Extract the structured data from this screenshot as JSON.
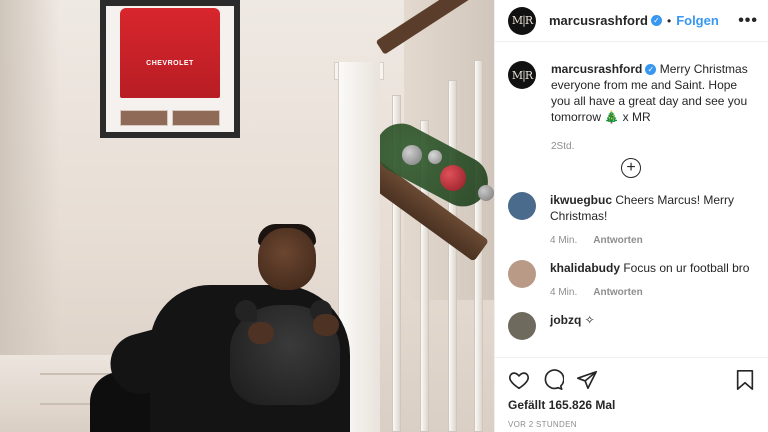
{
  "post": {
    "username": "marcusrashford",
    "verified_mark": "✓",
    "separator": "•",
    "follow_label": "Folgen",
    "more_label": "•••",
    "avatar_initials": "M|R",
    "caption_rest": " Merry Christmas everyone from me and Saint. Hope you all have a great day and see you tomorrow 🎄 x MR",
    "caption_time": "2Std.",
    "add_label": "+"
  },
  "jersey": {
    "sponsor": "CHEVROLET"
  },
  "comments": [
    {
      "user": "ikwuegbuc",
      "text": " Cheers Marcus! Merry Christmas!",
      "time": "4 Min.",
      "reply": "Antworten",
      "avatar_color": "#4a6b8c"
    },
    {
      "user": "khalidabudy",
      "text": " Focus on ur football bro",
      "time": "4 Min.",
      "reply": "Antworten",
      "avatar_color": "#b99a86"
    },
    {
      "user": "jobzq",
      "text": " ✧",
      "avatar_color": "#6f6a5e"
    }
  ],
  "actions": {
    "likes": "Gefällt 165.826 Mal",
    "posted": "VOR 2 STUNDEN"
  },
  "colors": {
    "link_blue": "#3897f0",
    "secondary_text": "#8e8e8e",
    "primary_text": "#262626",
    "verified": "#3897f0"
  },
  "icons": [
    "heart-icon",
    "comment-icon",
    "share-icon",
    "bookmark-icon",
    "more-icon",
    "add-comment-icon",
    "verified-icon"
  ]
}
